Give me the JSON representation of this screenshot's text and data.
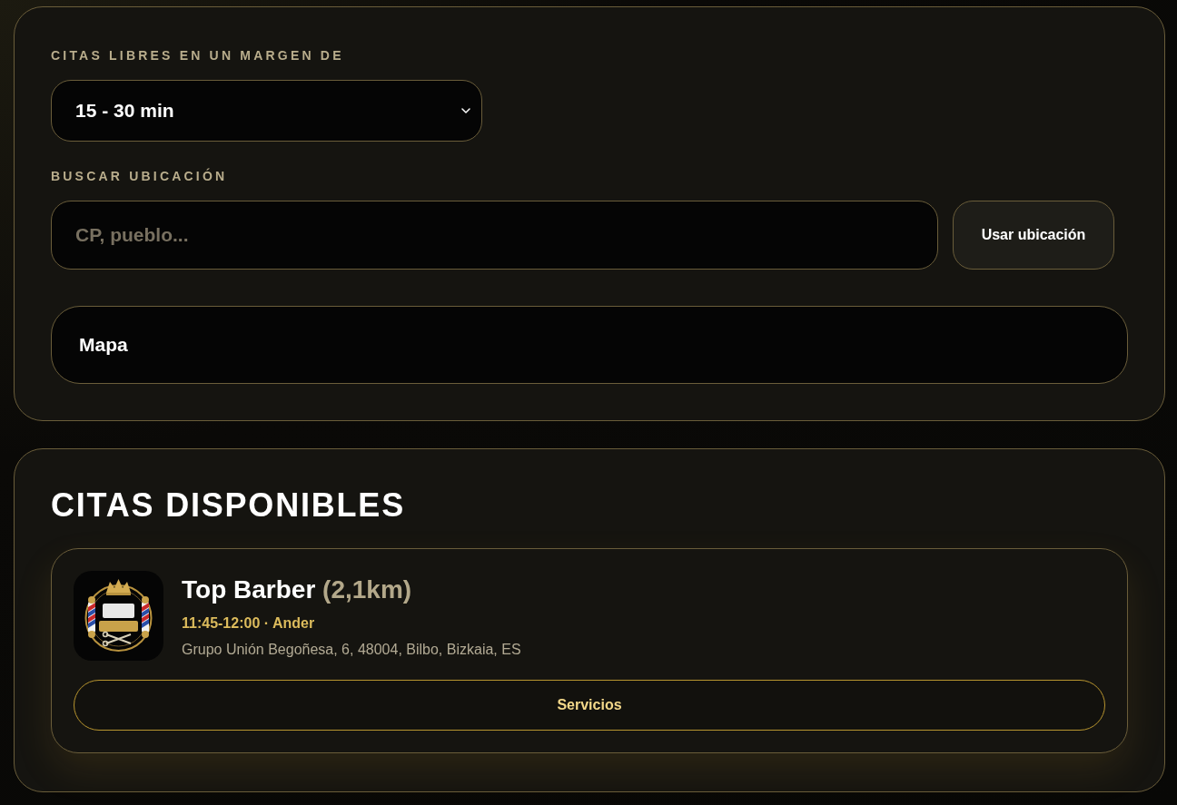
{
  "filters": {
    "margin": {
      "label": "CITAS LIBRES EN UN MARGEN DE",
      "value": "15 - 30 min"
    },
    "location": {
      "label": "BUSCAR UBICACIÓN",
      "placeholder": "CP, pueblo...",
      "button": "Usar ubicación"
    },
    "map": {
      "label": "Mapa"
    }
  },
  "appointments": {
    "title": "CITAS DISPONIBLES",
    "items": [
      {
        "name": "Top Barber",
        "distance": "(2,1km)",
        "slot": "11:45-12:00 · Ander",
        "address": "Grupo Unión Begoñesa, 6, 48004, Bilbo, Bizkaia, ES",
        "button": "Servicios"
      }
    ]
  }
}
